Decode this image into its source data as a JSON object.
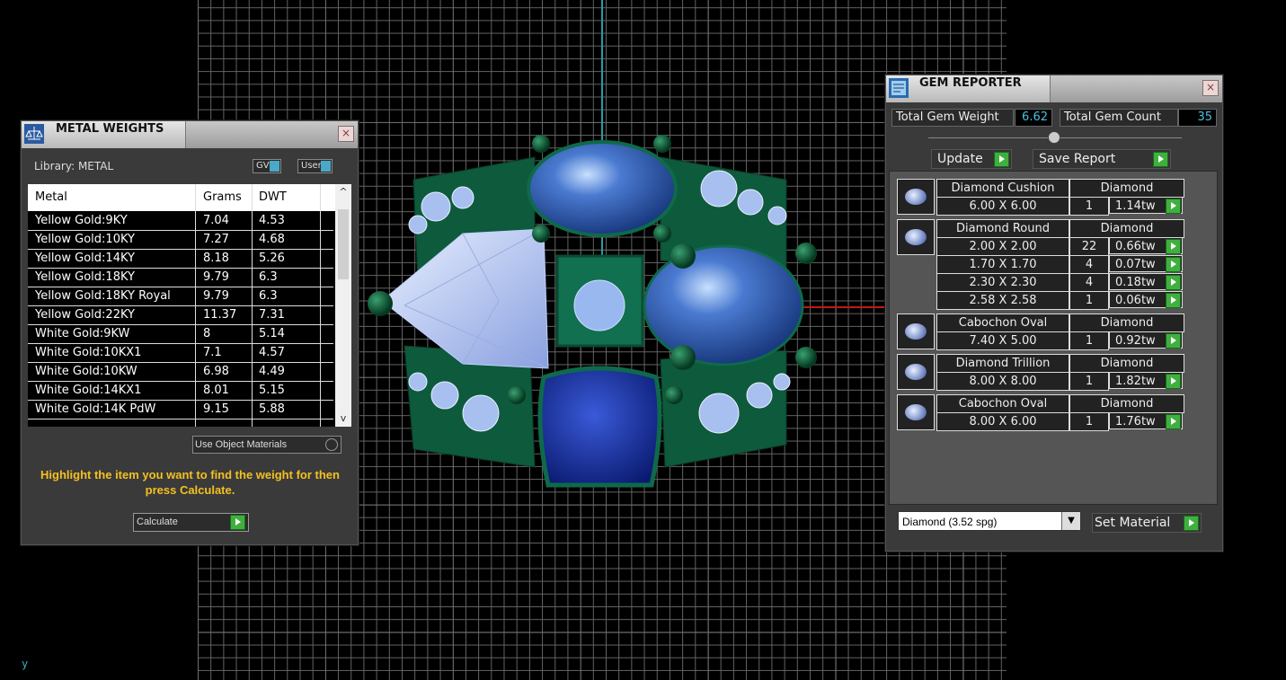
{
  "viewport": {
    "axis_label": "y"
  },
  "metal_weights": {
    "title": "METAL WEIGHTS",
    "close": "×",
    "library_label": "Library: METAL",
    "toggle_gv": "GV",
    "toggle_user": "User",
    "columns": [
      "Metal",
      "Grams",
      "DWT"
    ],
    "rows": [
      {
        "metal": "Yellow Gold:9KY",
        "grams": "7.04",
        "dwt": "4.53"
      },
      {
        "metal": "Yellow Gold:10KY",
        "grams": "7.27",
        "dwt": "4.68"
      },
      {
        "metal": "Yellow Gold:14KY",
        "grams": "8.18",
        "dwt": "5.26"
      },
      {
        "metal": "Yellow Gold:18KY",
        "grams": "9.79",
        "dwt": "6.3"
      },
      {
        "metal": "Yellow Gold:18KY Royal",
        "grams": "9.79",
        "dwt": "6.3"
      },
      {
        "metal": "Yellow Gold:22KY",
        "grams": "11.37",
        "dwt": "7.31"
      },
      {
        "metal": "White Gold:9KW",
        "grams": "8",
        "dwt": "5.14"
      },
      {
        "metal": "White Gold:10KX1",
        "grams": "7.1",
        "dwt": "4.57"
      },
      {
        "metal": "White Gold:10KW",
        "grams": "6.98",
        "dwt": "4.49"
      },
      {
        "metal": "White Gold:14KX1",
        "grams": "8.01",
        "dwt": "5.15"
      },
      {
        "metal": "White Gold:14K PdW",
        "grams": "9.15",
        "dwt": "5.88"
      }
    ],
    "use_object_materials": "Use Object Materials",
    "hint": "Highlight the item you want to find the weight for then press Calculate.",
    "calculate": "Calculate"
  },
  "gem_reporter": {
    "title": "GEM REPORTER",
    "close": "×",
    "total_weight_label": "Total Gem Weight",
    "total_weight_value": "6.62",
    "total_count_label": "Total Gem Count",
    "total_count_value": "35",
    "update": "Update",
    "save_report": "Save Report",
    "gems": [
      {
        "name": "Diamond Cushion",
        "material": "Diamond",
        "rows": [
          {
            "size": "6.00 X 6.00",
            "count": "1",
            "weight": "1.14tw"
          }
        ]
      },
      {
        "name": "Diamond Round",
        "material": "Diamond",
        "rows": [
          {
            "size": "2.00 X 2.00",
            "count": "22",
            "weight": "0.66tw"
          },
          {
            "size": "1.70 X 1.70",
            "count": "4",
            "weight": "0.07tw"
          },
          {
            "size": "2.30 X 2.30",
            "count": "4",
            "weight": "0.18tw"
          },
          {
            "size": "2.58 X 2.58",
            "count": "1",
            "weight": "0.06tw"
          }
        ]
      },
      {
        "name": "Cabochon Oval",
        "material": "Diamond",
        "rows": [
          {
            "size": "7.40 X 5.00",
            "count": "1",
            "weight": "0.92tw"
          }
        ]
      },
      {
        "name": "Diamond Trillion",
        "material": "Diamond",
        "rows": [
          {
            "size": "8.00 X 8.00",
            "count": "1",
            "weight": "1.82tw"
          }
        ]
      },
      {
        "name": "Cabochon Oval",
        "material": "Diamond",
        "rows": [
          {
            "size": "8.00 X 6.00",
            "count": "1",
            "weight": "1.76tw"
          }
        ]
      }
    ],
    "material_select": "Diamond    (3.52 spg)",
    "set_material": "Set Material"
  }
}
